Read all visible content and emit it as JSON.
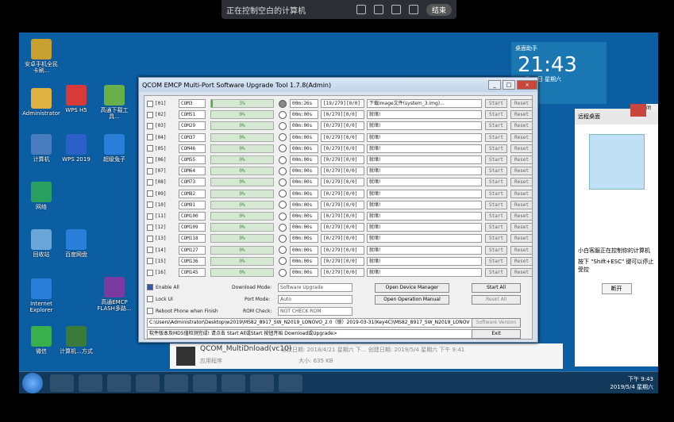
{
  "remote_bar": {
    "title": "正在控制空白的计算机",
    "end_label": "结束"
  },
  "desktop_icons": [
    {
      "label": "安卓手机全民卡刷..."
    },
    {
      "label": "Administrator"
    },
    {
      "label": "计算机"
    },
    {
      "label": "网络"
    },
    {
      "label": "回收站"
    },
    {
      "label": "Internet Explorer"
    },
    {
      "label": "微信"
    },
    {
      "label": "WPS H5"
    },
    {
      "label": "WPS 2019"
    },
    {
      "label": "超级兔子"
    },
    {
      "label": "百度网盘"
    },
    {
      "label": "高通下载工具..."
    },
    {
      "label": "计算机...方式"
    },
    {
      "label": "高通EMCP FLASH多路..."
    }
  ],
  "widget": {
    "time": "21:43",
    "date": "05月04日 星期六",
    "label": "桌面助手"
  },
  "app": {
    "title": "QCOM EMCP Multi-Port Software Upgrade Tool 1.7.8(Admin)",
    "rows": [
      {
        "idx": "[01]",
        "com": "COM3",
        "progress": "3%",
        "time": "00m:26s",
        "count": "[19/279][0/0]",
        "msg": "下载image文件(system_3.img)...",
        "start": "Start",
        "reset": "Reset"
      },
      {
        "idx": "[02]",
        "com": "COM51",
        "progress": "0%",
        "time": "00m:00s",
        "count": "[0/279][0/0]",
        "msg": "就绪!",
        "start": "Start",
        "reset": "Reset"
      },
      {
        "idx": "[03]",
        "com": "COM29",
        "progress": "0%",
        "time": "00m:00s",
        "count": "[0/279][0/0]",
        "msg": "就绪!",
        "start": "Start",
        "reset": "Reset"
      },
      {
        "idx": "[04]",
        "com": "COM37",
        "progress": "0%",
        "time": "00m:00s",
        "count": "[0/279][0/0]",
        "msg": "就绪!",
        "start": "Start",
        "reset": "Reset"
      },
      {
        "idx": "[05]",
        "com": "COM46",
        "progress": "0%",
        "time": "00m:00s",
        "count": "[0/279][0/0]",
        "msg": "就绪!",
        "start": "Start",
        "reset": "Reset"
      },
      {
        "idx": "[06]",
        "com": "COM55",
        "progress": "0%",
        "time": "00m:00s",
        "count": "[0/279][0/0]",
        "msg": "就绪!",
        "start": "Start",
        "reset": "Reset"
      },
      {
        "idx": "[07]",
        "com": "COM64",
        "progress": "0%",
        "time": "00m:00s",
        "count": "[0/279][0/0]",
        "msg": "就绪!",
        "start": "Start",
        "reset": "Reset"
      },
      {
        "idx": "[08]",
        "com": "COM73",
        "progress": "0%",
        "time": "00m:00s",
        "count": "[0/279][0/0]",
        "msg": "就绪!",
        "start": "Start",
        "reset": "Reset"
      },
      {
        "idx": "[09]",
        "com": "COM82",
        "progress": "0%",
        "time": "00m:00s",
        "count": "[0/279][0/0]",
        "msg": "就绪!",
        "start": "Start",
        "reset": "Reset"
      },
      {
        "idx": "[10]",
        "com": "COM91",
        "progress": "0%",
        "time": "00m:00s",
        "count": "[0/279][0/0]",
        "msg": "就绪!",
        "start": "Start",
        "reset": "Reset"
      },
      {
        "idx": "[11]",
        "com": "COM100",
        "progress": "0%",
        "time": "00m:00s",
        "count": "[0/279][0/0]",
        "msg": "就绪!",
        "start": "Start",
        "reset": "Reset"
      },
      {
        "idx": "[12]",
        "com": "COM109",
        "progress": "0%",
        "time": "00m:00s",
        "count": "[0/279][0/0]",
        "msg": "就绪!",
        "start": "Start",
        "reset": "Reset"
      },
      {
        "idx": "[13]",
        "com": "COM118",
        "progress": "0%",
        "time": "00m:00s",
        "count": "[0/279][0/0]",
        "msg": "就绪!",
        "start": "Start",
        "reset": "Reset"
      },
      {
        "idx": "[14]",
        "com": "COM127",
        "progress": "0%",
        "time": "00m:00s",
        "count": "[0/279][0/0]",
        "msg": "就绪!",
        "start": "Start",
        "reset": "Reset"
      },
      {
        "idx": "[15]",
        "com": "COM136",
        "progress": "0%",
        "time": "00m:00s",
        "count": "[0/279][0/0]",
        "msg": "就绪!",
        "start": "Start",
        "reset": "Reset"
      },
      {
        "idx": "[16]",
        "com": "COM145",
        "progress": "0%",
        "time": "00m:00s",
        "count": "[0/279][0/0]",
        "msg": "就绪!",
        "start": "Start",
        "reset": "Reset"
      }
    ],
    "options": {
      "enable_all": "Enable All",
      "lock_ui": "Lock UI",
      "reboot": "Reboot Phone when Finish",
      "download_mode_label": "Download Mode:",
      "download_mode": "Software Upgrade",
      "port_mode_label": "Port Mode:",
      "port_mode": "Auto",
      "rom_check_label": "ROM Check:",
      "rom_check": "NOT CHECK ROM"
    },
    "buttons": {
      "device_manager": "Open Device Manager",
      "op_manual": "Open Operation Manual",
      "start_all": "Start All",
      "reset_all": "Reset All",
      "sw_version": "Software Version",
      "exit": "Exit"
    },
    "path": "C:\\Users\\Administrator\\Desktop\\w2019\\MS82_8917_SW_N2019_LONOVO_2.0（锁）2019-03-31(Key4C)\\MS82_8917_SW_N2019_LONOV",
    "status": "软件版本及MD5值检测完成! 请点击 Start All或Start 按钮开始 Download或Upgrade>"
  },
  "download_item": {
    "name": "QCOM_MultiDnload(vc10)",
    "meta": "修改日期: 2018/4/21 星期六 下... 创建日期: 2019/5/4 星期六 下午 9:41",
    "type": "应用程序",
    "size": "大小: 635 KB"
  },
  "remote_panel": {
    "title": "远程桌面",
    "text": "小白客服正在控制你的计算机",
    "hint": "按下 \"Shift+ESC\" 键可以停止受控",
    "disconnect": "断开",
    "close": "关闭"
  },
  "clock": {
    "time": "下午 9:43",
    "date": "2019/5/4 星期六"
  }
}
